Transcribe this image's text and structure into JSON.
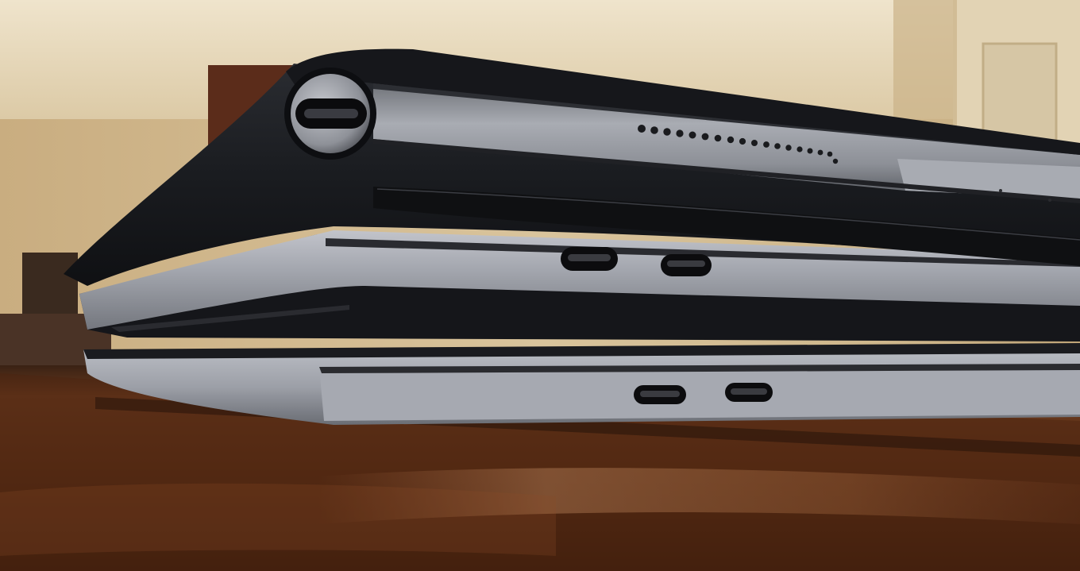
{
  "scene": {
    "subject": "stacked-devices-side-view",
    "colors": {
      "wall": "#cdb48a",
      "wall_light": "#e9dcc0",
      "table": "#5a2d14",
      "table_highlight": "#a0603a",
      "leather": "#1b1d21",
      "aluminum": "#9a9ca4",
      "aluminum_light": "#c9cbd2",
      "port": "#0c0c0e"
    },
    "objects": [
      {
        "name": "keyboard-folio-case",
        "material": "leather"
      },
      {
        "name": "tablet",
        "material": "aluminum",
        "speaker_holes": 20,
        "ports": 0
      },
      {
        "name": "laptop-upper",
        "material": "aluminum",
        "ports": 2
      },
      {
        "name": "laptop-lower",
        "material": "aluminum",
        "ports": 2
      }
    ]
  }
}
